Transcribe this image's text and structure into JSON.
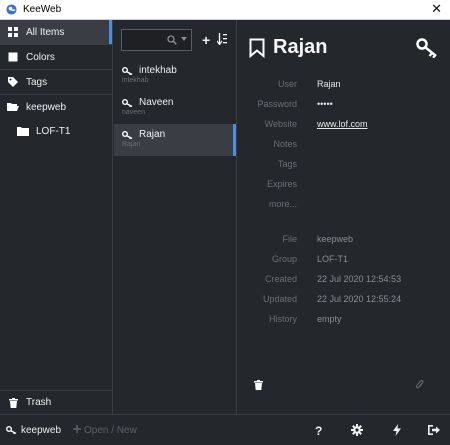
{
  "window": {
    "title": "KeeWeb",
    "close_glyph": "✕"
  },
  "menu": {
    "items": [
      {
        "label": "All Items",
        "icon": "grid-icon"
      },
      {
        "label": "Colors",
        "icon": "color-square-icon"
      },
      {
        "label": "Tags",
        "icon": "tags-icon"
      },
      {
        "label": "keepweb",
        "icon": "folder-open-icon"
      },
      {
        "label": "LOF-T1",
        "icon": "folder-icon"
      }
    ],
    "trash": {
      "label": "Trash",
      "icon": "trash-icon"
    }
  },
  "list": {
    "search": {
      "value": "",
      "placeholder": ""
    },
    "add_glyph": "+",
    "entries": [
      {
        "title": "intekhab",
        "subtitle": "intekhab"
      },
      {
        "title": "Naveen",
        "subtitle": "naveen"
      },
      {
        "title": "Rajan",
        "subtitle": "Rajan"
      }
    ]
  },
  "details": {
    "title": "Rajan",
    "fields": [
      {
        "label": "User",
        "value": "Rajan"
      },
      {
        "label": "Password",
        "value": "•••••"
      },
      {
        "label": "Website",
        "value": "www.lof.com"
      },
      {
        "label": "Notes",
        "value": ""
      },
      {
        "label": "Tags",
        "value": ""
      },
      {
        "label": "Expires",
        "value": ""
      },
      {
        "label": "more...",
        "value": ""
      },
      {
        "label": "File",
        "value": "keepweb"
      },
      {
        "label": "Group",
        "value": "LOF-T1"
      },
      {
        "label": "Created",
        "value": "22 Jul 2020 12:54:53"
      },
      {
        "label": "Updated",
        "value": "22 Jul 2020 12:55:24"
      },
      {
        "label": "History",
        "value": "empty"
      }
    ]
  },
  "footer": {
    "db_name": "keepweb",
    "open_new": "Open / New",
    "help_glyph": "?"
  },
  "colors": {
    "accent": "#4a90e2",
    "background": "#24272b",
    "selected": "#3a3e44"
  }
}
